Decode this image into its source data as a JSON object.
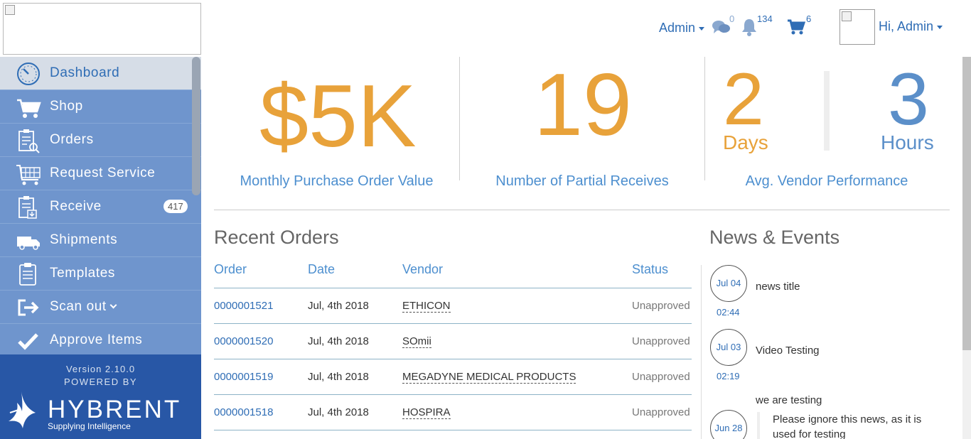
{
  "header": {
    "admin_menu_label": "Admin",
    "messages_count": "0",
    "notifications_count": "134",
    "cart_count": "6",
    "user_greeting": "Hi, Admin"
  },
  "sidebar": {
    "items": [
      {
        "label": "Dashboard",
        "icon": "dashboard-clock-icon"
      },
      {
        "label": "Shop",
        "icon": "cart-icon"
      },
      {
        "label": "Orders",
        "icon": "clipboard-search-icon"
      },
      {
        "label": "Request Service",
        "icon": "service-cart-icon"
      },
      {
        "label": "Receive",
        "icon": "clipboard-receive-icon",
        "badge": "417"
      },
      {
        "label": "Shipments",
        "icon": "truck-icon"
      },
      {
        "label": "Templates",
        "icon": "clipboard-icon"
      },
      {
        "label": "Scan out",
        "icon": "sign-out-icon"
      },
      {
        "label": "Approve Items",
        "icon": "check-icon"
      }
    ],
    "version": "Version 2.10.0",
    "powered_by": "POWERED BY",
    "brand_name": "HYBRENT",
    "brand_tagline": "Supplying Intelligence"
  },
  "kpis": {
    "purchase_value": "$5K",
    "purchase_label": "Monthly Purchase Order Value",
    "partial_receives": "19",
    "partial_label": "Number of Partial Receives",
    "days_value": "2",
    "days_unit": "Days",
    "hours_value": "3",
    "hours_unit": "Hours",
    "vendor_label": "Avg. Vendor Performance"
  },
  "orders": {
    "title": "Recent Orders",
    "columns": [
      "Order",
      "Date",
      "Vendor",
      "Status"
    ],
    "rows": [
      {
        "order": "0000001521",
        "date": "Jul, 4th 2018",
        "vendor": "ETHICON",
        "status": "Unapproved"
      },
      {
        "order": "0000001520",
        "date": "Jul, 4th 2018",
        "vendor": "SOmii",
        "status": "Unapproved"
      },
      {
        "order": "0000001519",
        "date": "Jul, 4th 2018",
        "vendor": "MEGADYNE MEDICAL PRODUCTS",
        "status": "Unapproved"
      },
      {
        "order": "0000001518",
        "date": "Jul, 4th 2018",
        "vendor": "HOSPIRA",
        "status": "Unapproved"
      }
    ]
  },
  "news": {
    "title": "News & Events",
    "items": [
      {
        "date": "Jul 04",
        "time": "02:44",
        "title": "news title"
      },
      {
        "date": "Jul 03",
        "time": "02:19",
        "title": "Video Testing"
      },
      {
        "date": "Jun 28",
        "title": "we are testing",
        "body": "Please ignore this news, as it is used for testing"
      }
    ]
  },
  "colors": {
    "brand_blue": "#2f6db5",
    "sidebar_blue": "#6f95cd",
    "accent_orange": "#e8a23a",
    "footer_blue": "#2857a6"
  }
}
